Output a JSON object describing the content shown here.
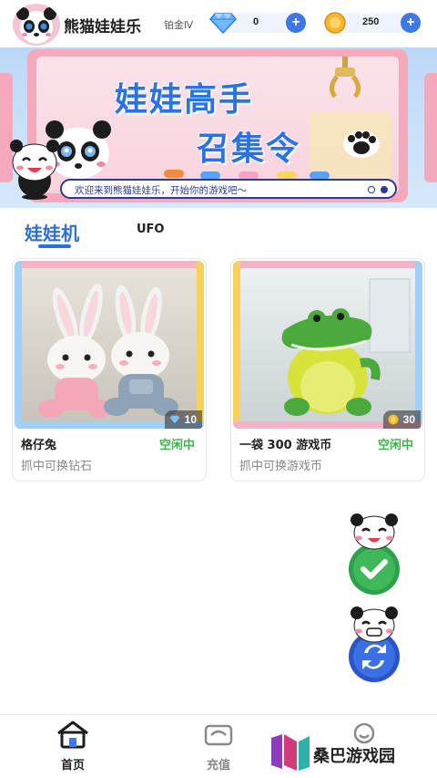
{
  "header": {
    "app_title": "熊猫娃娃乐",
    "rank": "铂金Ⅳ",
    "diamond_count": "0",
    "coin_count": "250",
    "diamond_icon": "diamond-icon",
    "coin_icon": "coin-icon",
    "add_icon": "plus-icon"
  },
  "banner": {
    "title_line1": "娃娃高手",
    "title_line2": "召集令",
    "ticker": "欢迎来到熊猫娃娃乐，开始你的游戏吧～",
    "slide_count": 2,
    "active_slide": 1
  },
  "tabs": [
    {
      "label": "娃娃机",
      "active": true
    },
    {
      "label": "UFO",
      "active": false
    }
  ],
  "machines": [
    {
      "name": "格仔兔",
      "status": "空闲中",
      "subtitle": "抓中可换钻石",
      "price": "10",
      "price_icon": "diamond-icon"
    },
    {
      "name": "一袋 300 游戏币",
      "status": "空闲中",
      "subtitle": "抓中可换游戏币",
      "price": "30",
      "price_icon": "coin-icon"
    }
  ],
  "bottom_nav": [
    {
      "label": "首页",
      "icon": "home-icon",
      "active": true
    },
    {
      "label": "充值",
      "icon": "wallet-icon",
      "active": false
    }
  ],
  "watermark": {
    "text": "桑巴游戏园"
  },
  "colors": {
    "accent": "#2f6fd8",
    "status_green": "#39b54a",
    "nav_active": "#222222",
    "nav_inactive": "#888888"
  }
}
